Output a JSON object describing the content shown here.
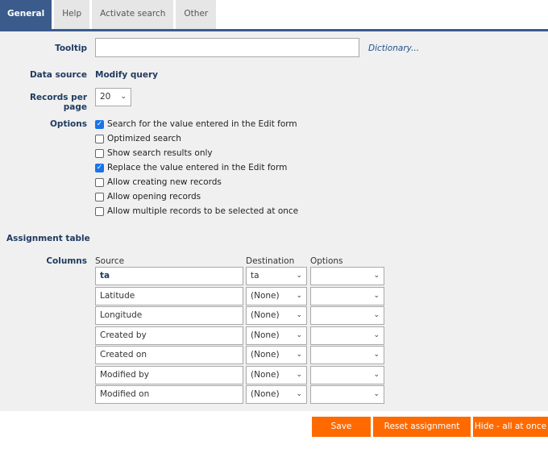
{
  "tabs": [
    "General",
    "Help",
    "Activate search",
    "Other"
  ],
  "form": {
    "tooltip_label": "Tooltip",
    "tooltip_value": "",
    "dictionary_link": "Dictionary...",
    "data_source_label": "Data source",
    "data_source_value": "Modify query",
    "records_label": "Records per page",
    "records_value": "20",
    "options_label": "Options",
    "options": [
      {
        "label": "Search for the value entered in the Edit form",
        "checked": true
      },
      {
        "label": "Optimized search",
        "checked": false
      },
      {
        "label": "Show search results only",
        "checked": false
      },
      {
        "label": "Replace the value entered in the Edit form",
        "checked": true
      },
      {
        "label": "Allow creating new records",
        "checked": false
      },
      {
        "label": "Allow opening records",
        "checked": false
      },
      {
        "label": "Allow multiple records to be selected at once",
        "checked": false
      }
    ]
  },
  "assignment": {
    "title": "Assignment table",
    "columns_label": "Columns",
    "headers": [
      "Source",
      "Destination",
      "Options"
    ],
    "rows": [
      {
        "source": "ta",
        "destination": "ta",
        "options": ""
      },
      {
        "source": "Latitude",
        "destination": "(None)",
        "options": ""
      },
      {
        "source": "Longitude",
        "destination": "(None)",
        "options": ""
      },
      {
        "source": "Created by",
        "destination": "(None)",
        "options": ""
      },
      {
        "source": "Created on",
        "destination": "(None)",
        "options": ""
      },
      {
        "source": "Modified by",
        "destination": "(None)",
        "options": ""
      },
      {
        "source": "Modified on",
        "destination": "(None)",
        "options": ""
      }
    ]
  },
  "buttons": {
    "save": "Save",
    "reset": "Reset assignment table",
    "hide": "Hide - all at once"
  },
  "colors": {
    "accent": "#3b5b8c",
    "button": "#ff6a00",
    "checkbox": "#1a73e8"
  }
}
